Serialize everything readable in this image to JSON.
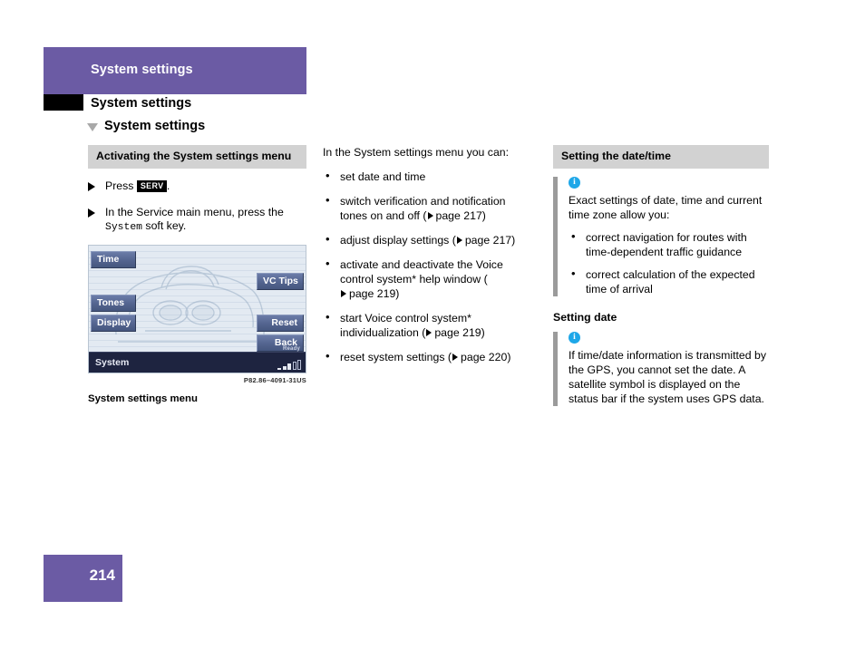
{
  "header": {
    "band_title": "System settings",
    "chapter_title": "System settings",
    "section_title": "System settings"
  },
  "left_column": {
    "subhead": "Activating the System settings menu",
    "steps": [
      {
        "before": "Press ",
        "keycap": "SERV",
        "after": "."
      },
      {
        "before": "In the Service main menu, press the ",
        "mono": "System",
        "after": " soft key."
      }
    ],
    "screen": {
      "buttons_left": [
        "Time",
        "Tones",
        "Display"
      ],
      "buttons_right": [
        "VC Tips",
        "Reset",
        "Back"
      ],
      "status_label": "System",
      "status_ready": "Ready"
    },
    "figure_code": "P82.86–4091-31US",
    "figure_caption": "System settings menu"
  },
  "middle_column": {
    "lead": "In the System settings menu you can:",
    "bullets": [
      {
        "text": "set date and time",
        "ref": ""
      },
      {
        "text": "switch verification and notification tones on and off (",
        "ref": "page 217",
        "tail": ")"
      },
      {
        "text": "adjust display settings (",
        "ref": "page 217",
        "tail": ")"
      },
      {
        "text": "activate and deactivate the Voice control system* help window (",
        "ref": "page 219",
        "tail": ")"
      },
      {
        "text": "start Voice control system* individualization (",
        "ref": "page 219",
        "tail": ")"
      },
      {
        "text": "reset system settings (",
        "ref": "page 220",
        "tail": ")"
      }
    ]
  },
  "right_column": {
    "subhead": "Setting the date/time",
    "note1": {
      "icon": "i",
      "text": "Exact settings of date, time and current time zone allow you:",
      "bullets": [
        "correct navigation for routes with time-dependent traffic guidance",
        "correct calculation of the expected time of arrival"
      ]
    },
    "subhead2": "Setting date",
    "note2": {
      "icon": "i",
      "text": "If time/date information is transmitted by the GPS, you cannot set the date. A satellite symbol is displayed on the status bar if the system uses GPS data."
    }
  },
  "footer": {
    "page_number": "214"
  },
  "colors": {
    "accent_purple": "#6b5ba4",
    "gray_head": "#d2d2d2",
    "note_bar": "#9b9b9b",
    "info_blue": "#1ea7e8",
    "screen_button": "#53648f",
    "screen_statusbar": "#1e2440"
  }
}
